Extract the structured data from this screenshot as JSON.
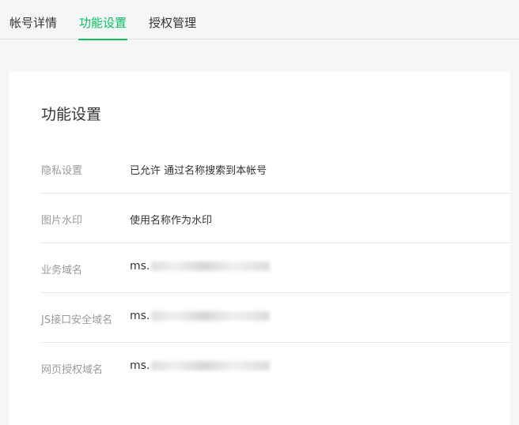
{
  "tabs": [
    {
      "label": "帐号详情",
      "active": false
    },
    {
      "label": "功能设置",
      "active": true
    },
    {
      "label": "授权管理",
      "active": false
    }
  ],
  "colors": {
    "accent": "#07c160",
    "background": "#f5f6f7",
    "card": "#ffffff",
    "label": "#9a9a9a",
    "text": "#353535"
  },
  "card": {
    "title": "功能设置",
    "rows": [
      {
        "label": "隐私设置",
        "value": "已允许 通过名称搜索到本帐号"
      },
      {
        "label": "图片水印",
        "value": "使用名称作为水印"
      },
      {
        "label": "业务域名",
        "value": "ms."
      },
      {
        "label": "JS接口安全域名",
        "value": "ms."
      },
      {
        "label": "网页授权域名",
        "value": "ms."
      }
    ]
  }
}
